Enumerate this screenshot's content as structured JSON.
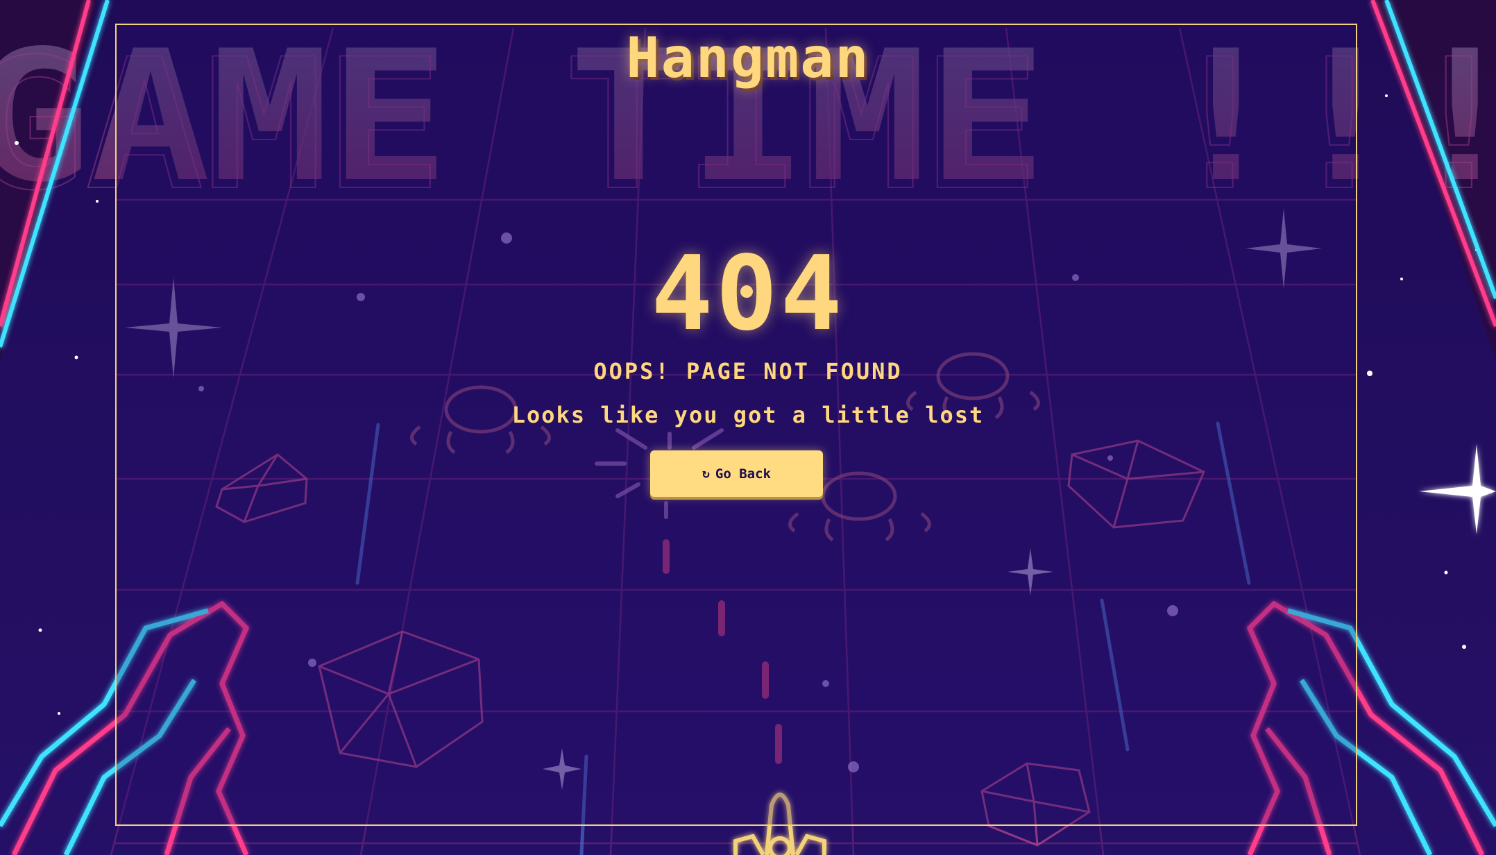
{
  "game": {
    "title": "Hangman",
    "background_banner": "GAME TIME !!!"
  },
  "error": {
    "code": "404",
    "heading": "OOPS! PAGE NOT FOUND",
    "message": "Looks like you got a little lost"
  },
  "actions": {
    "go_back_icon": "refresh-icon",
    "go_back_icon_glyph": "↻",
    "go_back_label": "Go Back"
  },
  "colors": {
    "background": "#1d0c4f",
    "accent_yellow": "#ffd77e",
    "neon_pink": "#ff3d8b",
    "neon_cyan": "#3fe3ff",
    "grid_line": "#8a2d7e"
  }
}
